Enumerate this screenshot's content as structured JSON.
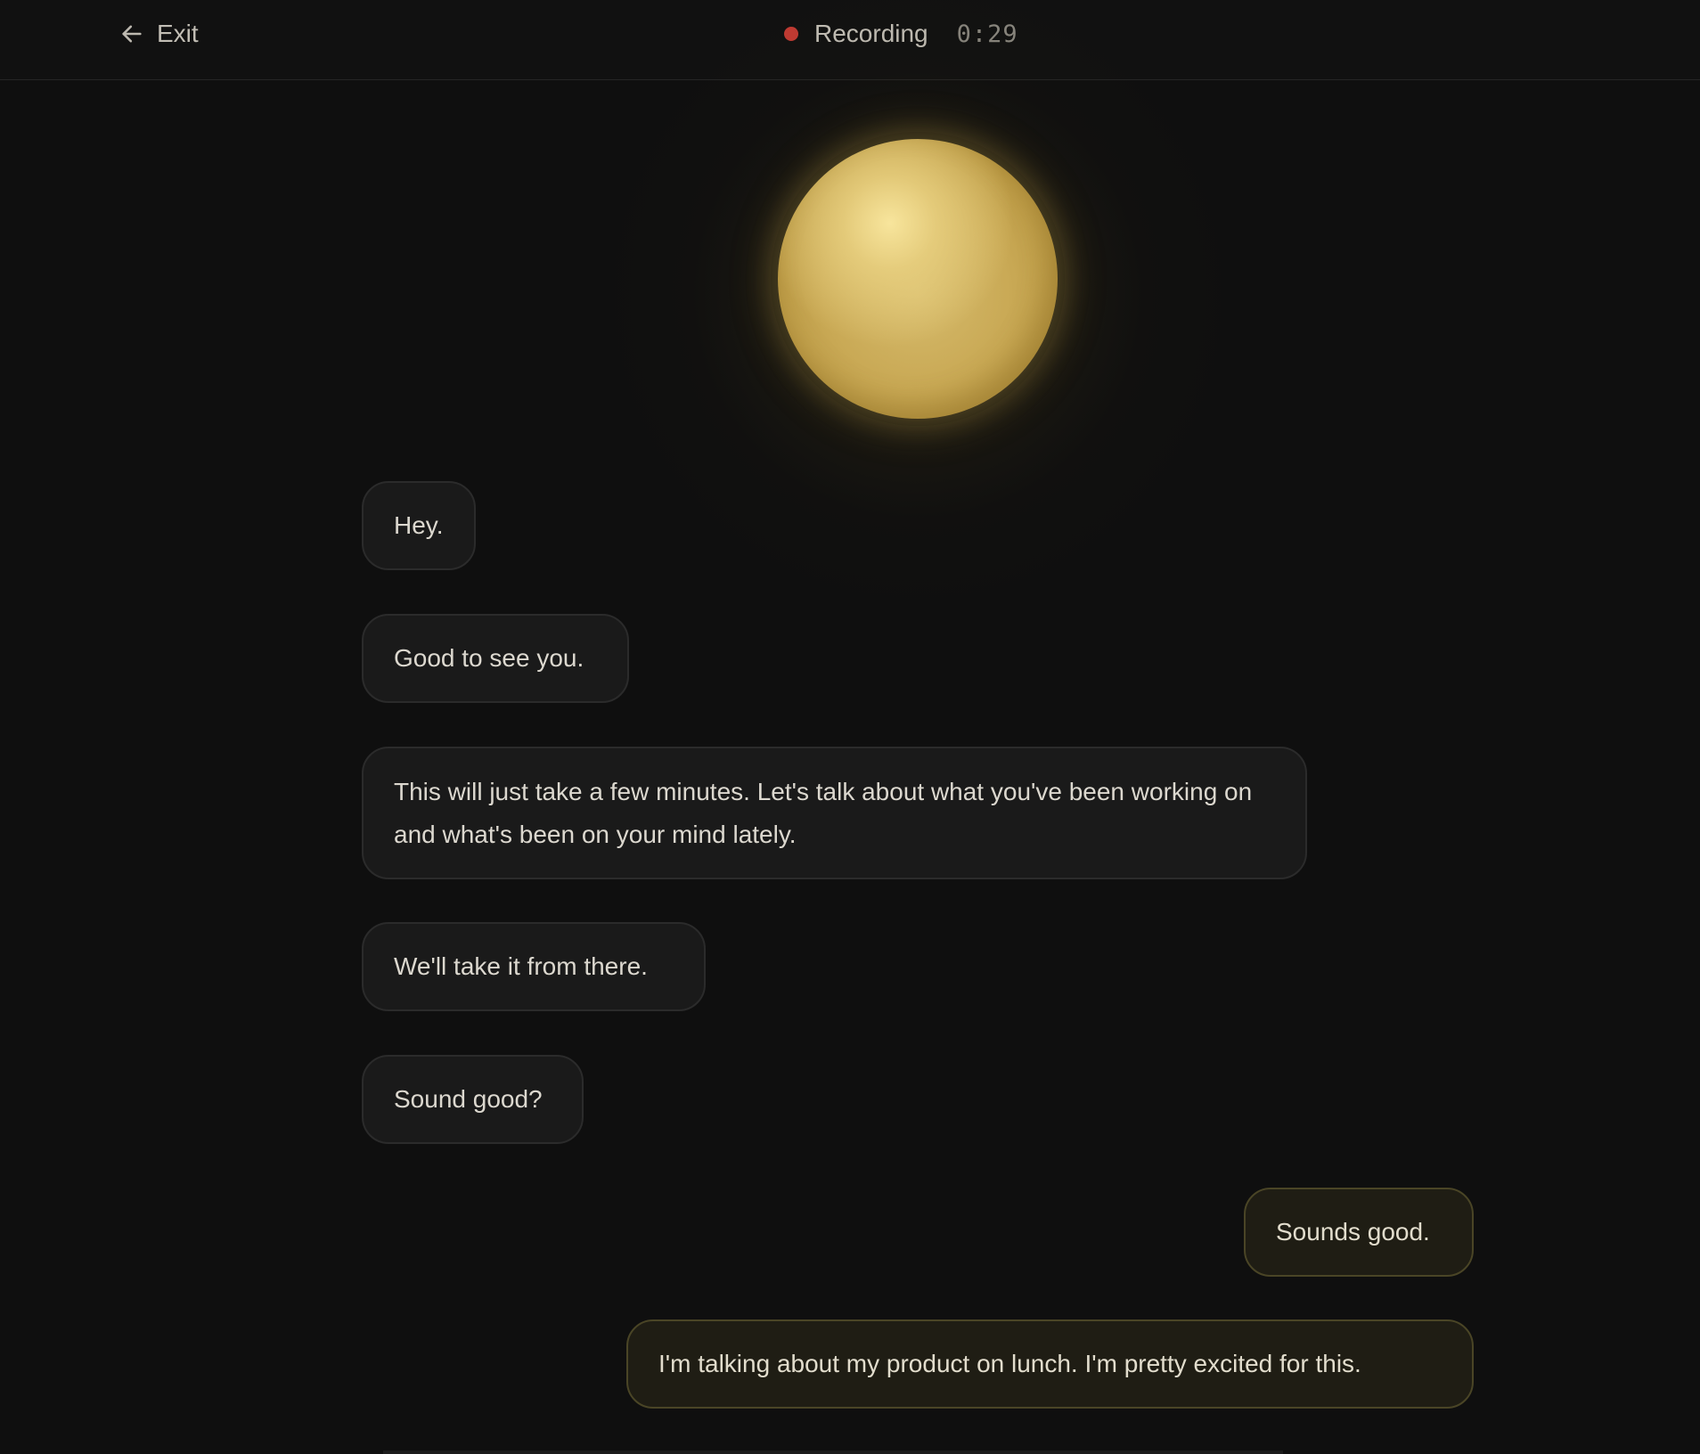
{
  "header": {
    "exit_label": "Exit",
    "recording_label": "Recording",
    "timer": "0:29",
    "recording_color": "#c23b33"
  },
  "orb": {
    "color": "#c9a955"
  },
  "messages": [
    {
      "role": "agent",
      "text": "Hey."
    },
    {
      "role": "agent",
      "text": "Good to see you."
    },
    {
      "role": "agent",
      "text": "This will just take a few minutes. Let's talk about what you've been working on and what's been on your mind lately."
    },
    {
      "role": "agent",
      "text": "We'll take it from there."
    },
    {
      "role": "agent",
      "text": "Sound good?"
    },
    {
      "role": "user",
      "text": "Sounds good."
    },
    {
      "role": "user",
      "text": "I'm talking about my product on lunch. I'm pretty excited for this."
    }
  ]
}
